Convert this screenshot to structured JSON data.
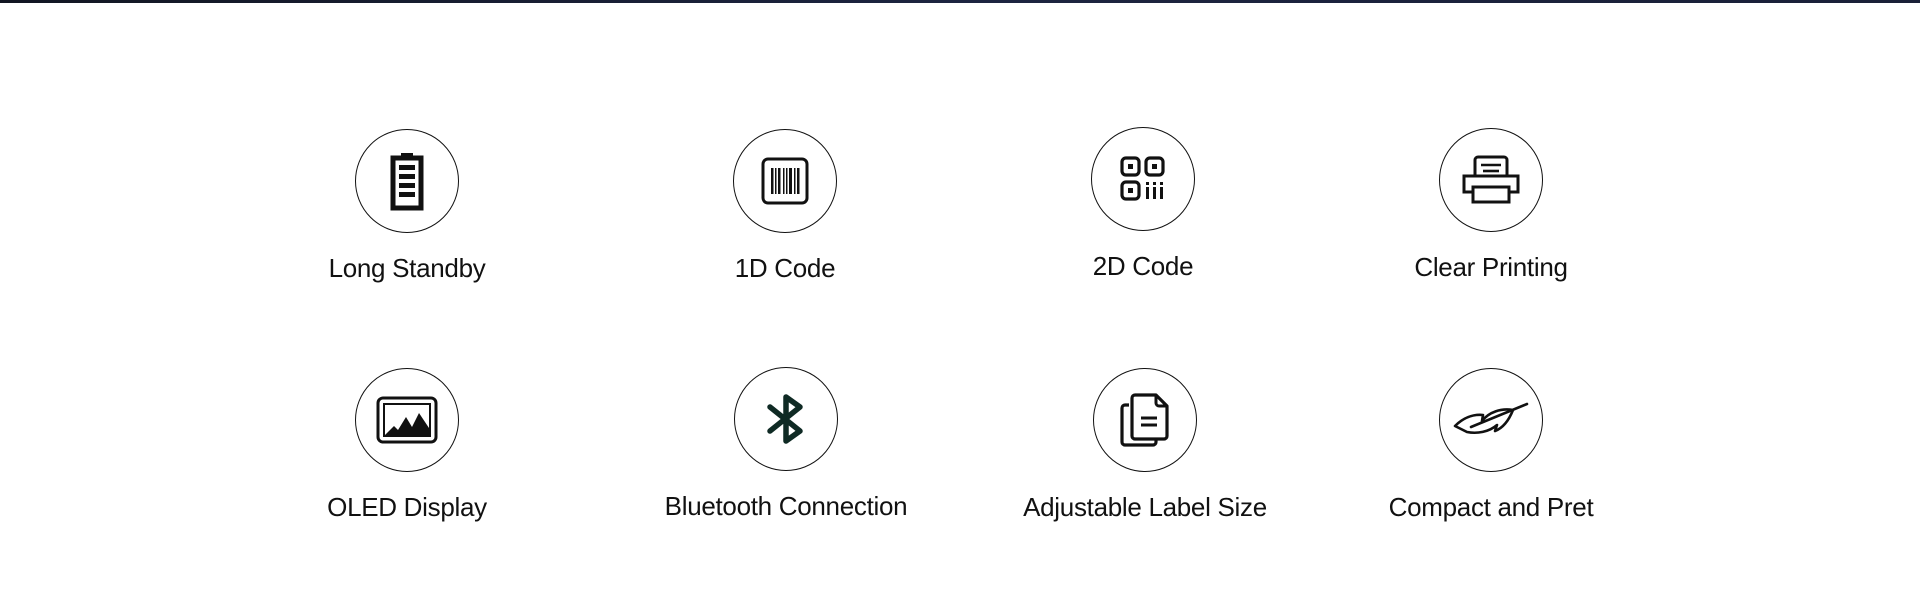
{
  "section": {
    "accent_color": "#1c2440",
    "icon_color": "#111111",
    "bluetooth_icon_color": "#0f2a24"
  },
  "features": [
    {
      "label": "Long Standby",
      "icon": "battery-icon"
    },
    {
      "label": "1D Code",
      "icon": "barcode-icon"
    },
    {
      "label": "2D Code",
      "icon": "qr-code-icon"
    },
    {
      "label": "Clear Printing",
      "icon": "printer-icon"
    },
    {
      "label": "OLED Display",
      "icon": "image-display-icon"
    },
    {
      "label": "Bluetooth Connection",
      "icon": "bluetooth-icon"
    },
    {
      "label": "Adjustable Label Size",
      "icon": "documents-icon"
    },
    {
      "label": "Compact and Pret",
      "icon": "feather-icon"
    }
  ]
}
